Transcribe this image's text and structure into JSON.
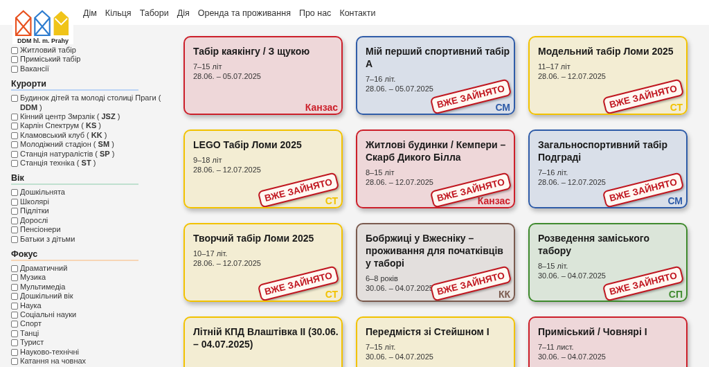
{
  "logo": {
    "caption": "DDM hl. m. Prahy"
  },
  "nav": [
    {
      "label": "Дім"
    },
    {
      "label": "Кільця"
    },
    {
      "label": "Табори"
    },
    {
      "label": "Дія"
    },
    {
      "label": "Оренда та проживання"
    },
    {
      "label": "Про нас"
    },
    {
      "label": "Контакти"
    }
  ],
  "filters": [
    {
      "items": [
        {
          "label": "Житловий табір",
          "checked": false
        },
        {
          "label": "Приміський табір",
          "checked": false
        },
        {
          "label": "Вакансії",
          "checked": false
        }
      ]
    },
    {
      "title": "Курорти",
      "color": "#b9d3f5",
      "items": [
        {
          "label": "Будинок дітей та молоді столиці Праги ( **DDM** )",
          "checked": false
        },
        {
          "label": "Кінний центр Змрзлік ( **JSZ** )",
          "checked": false
        },
        {
          "label": "Карлін Спектрум ( **KS** )",
          "checked": false
        },
        {
          "label": "Кламовський клуб ( **KK** )",
          "checked": false
        },
        {
          "label": "Молодіжний стадіон ( **SM** )",
          "checked": false
        },
        {
          "label": "Станція натуралістів ( **SP** )",
          "checked": false
        },
        {
          "label": "Станція техніка ( **ST** )",
          "checked": false
        }
      ]
    },
    {
      "title": "Вік",
      "color": "#bfe0cf",
      "items": [
        {
          "label": "Дошкільнята",
          "checked": false
        },
        {
          "label": "Школярі",
          "checked": false
        },
        {
          "label": "Підлітки",
          "checked": false
        },
        {
          "label": "Дорослі",
          "checked": false
        },
        {
          "label": "Пенсіонери",
          "checked": false
        },
        {
          "label": "Батьки з дітьми",
          "checked": false
        }
      ]
    },
    {
      "title": "Фокус",
      "color": "#f7d5b5",
      "items": [
        {
          "label": "Драматичний",
          "checked": false
        },
        {
          "label": "Музика",
          "checked": false
        },
        {
          "label": "Мультимедіа",
          "checked": false
        },
        {
          "label": "Дошкільний вік",
          "checked": false
        },
        {
          "label": "Наука",
          "checked": false
        },
        {
          "label": "Соціальні науки",
          "checked": false
        },
        {
          "label": "Спорт",
          "checked": false
        },
        {
          "label": "Танці",
          "checked": false
        },
        {
          "label": "Турист",
          "checked": false
        },
        {
          "label": "Науково-технічні",
          "checked": false
        },
        {
          "label": "Катання на човнах",
          "checked": false
        }
      ]
    }
  ],
  "camps": [
    {
      "title": "Табір каякінгу / З щукою",
      "ages": "7–15 літ",
      "dates": "28.06. – 05.07.2025",
      "place": "Канзас",
      "color": "#cc1f2a"
    },
    {
      "title": "Мій перший спортивний табір А",
      "ages": "7–16 літ.",
      "dates": "28.06. – 05.07.2025",
      "place": "СМ",
      "color": "#2f5ca8",
      "stamp": "ВЖЕ ЗАЙНЯТО"
    },
    {
      "title": "Модельний табір Ломи 2025",
      "ages": "11–17 літ",
      "dates": "28.06. – 12.07.2025",
      "place": "СТ",
      "color": "#f2c200",
      "stamp": "ВЖЕ ЗАЙНЯТО"
    },
    {
      "title": "LEGO Табір Ломи 2025",
      "ages": "9–18 літ",
      "dates": "28.06. – 12.07.2025",
      "place": "СТ",
      "color": "#f2c200",
      "stamp": "ВЖЕ ЗАЙНЯТО"
    },
    {
      "title": "Житлові будинки / Кемпери – Скарб Дикого Білла",
      "ages": "8–15 літ",
      "dates": "28.06. – 12.07.2025",
      "place": "Канзас",
      "color": "#cc1f2a",
      "stamp": "ВЖЕ ЗАЙНЯТО"
    },
    {
      "title": "Загальноспортивний табір Подграді",
      "ages": "7–16 літ.",
      "dates": "28.06. – 12.07.2025",
      "place": "СМ",
      "color": "#2f5ca8",
      "stamp": "ВЖЕ ЗАЙНЯТО"
    },
    {
      "title": "Творчий табір Ломи 2025",
      "ages": "10–17 літ.",
      "dates": "28.06. – 12.07.2025",
      "place": "СТ",
      "color": "#f2c200",
      "stamp": "ВЖЕ ЗАЙНЯТО"
    },
    {
      "title": "Бобржиці у Вжесніку – проживання для початківців у таборі",
      "ages": "6–8 років",
      "dates": "30.06. – 04.07.2025",
      "place": "КК",
      "color": "#7a5a4e",
      "stamp": "ВЖЕ ЗАЙНЯТО"
    },
    {
      "title": "Розведення заміського табору",
      "ages": "8–15 літ.",
      "dates": "30.06. – 04.07.2025",
      "place": "СП",
      "color": "#3f8a2e",
      "stamp": "ВЖЕ ЗАЙНЯТО"
    },
    {
      "title": "Літній КПД Влаштівка II (30.06. – 04.07.2025)",
      "color": "#f2c200"
    },
    {
      "title": "Передмістя зі Стейшном I",
      "ages": "7–15 літ.",
      "dates": "30.06. – 04.07.2025",
      "color": "#f2c200"
    },
    {
      "title": "Приміський / Човнярі I",
      "ages": "7–11 лист.",
      "dates": "30.06. – 04.07.2025",
      "color": "#cc1f2a"
    }
  ]
}
